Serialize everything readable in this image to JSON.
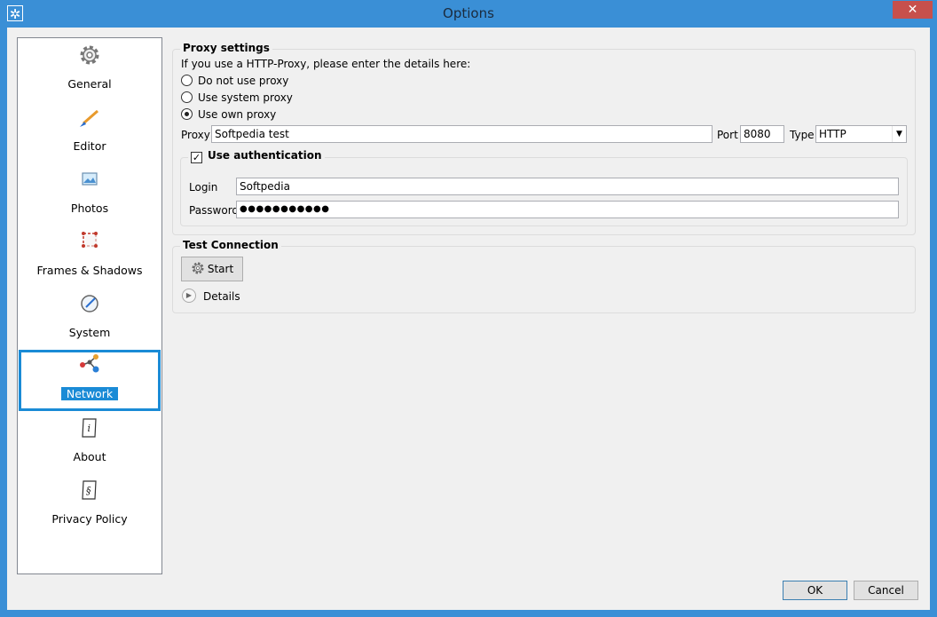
{
  "window": {
    "title": "Options",
    "close_label": "✕"
  },
  "sidebar": {
    "items": [
      {
        "label": "General",
        "icon": "gear-icon"
      },
      {
        "label": "Editor",
        "icon": "brush-icon"
      },
      {
        "label": "Photos",
        "icon": "photo-icon"
      },
      {
        "label": "Frames & Shadows",
        "icon": "frame-icon"
      },
      {
        "label": "System",
        "icon": "system-icon"
      },
      {
        "label": "Network",
        "icon": "network-icon",
        "selected": true
      },
      {
        "label": "About",
        "icon": "info-icon"
      },
      {
        "label": "Privacy Policy",
        "icon": "section-icon"
      }
    ]
  },
  "proxy": {
    "group_title": "Proxy settings",
    "intro": "If you use a HTTP-Proxy, please enter the details here:",
    "options": [
      {
        "label": "Do not use proxy",
        "checked": false
      },
      {
        "label": "Use system proxy",
        "checked": false
      },
      {
        "label": "Use own proxy",
        "checked": true
      }
    ],
    "proxy_label": "Proxy",
    "proxy_value": "Softpedia test",
    "port_label": "Port",
    "port_value": "8080",
    "type_label": "Type",
    "type_value": "HTTP",
    "auth": {
      "label": "Use authentication",
      "checked": true,
      "login_label": "Login",
      "login_value": "Softpedia",
      "password_label": "Password",
      "password_value": "●●●●●●●●●●●"
    }
  },
  "test": {
    "group_title": "Test Connection",
    "start_label": "Start",
    "details_label": "Details"
  },
  "footer": {
    "ok_label": "OK",
    "cancel_label": "Cancel"
  },
  "colors": {
    "titlebar": "#3a8fd6",
    "selection": "#1a8bd6",
    "close": "#c7504c"
  }
}
